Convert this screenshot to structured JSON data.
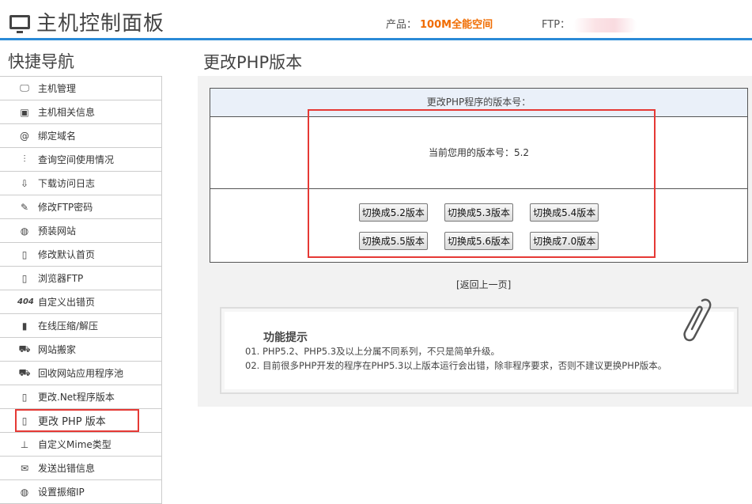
{
  "header": {
    "title": "主机控制面板",
    "product_label": "产品：",
    "product_value": "100M全能空间",
    "ftp_label": "FTP："
  },
  "sidebar": {
    "title": "快捷导航",
    "items": [
      {
        "label": "主机管理",
        "icon": "monitor-icon"
      },
      {
        "label": "主机相关信息",
        "icon": "screen-info-icon"
      },
      {
        "label": "绑定域名",
        "icon": "at-icon"
      },
      {
        "label": "查询空间使用情况",
        "icon": "chart-icon"
      },
      {
        "label": "下载访问日志",
        "icon": "download-icon"
      },
      {
        "label": "修改FTP密码",
        "icon": "edit-icon"
      },
      {
        "label": "预装网站",
        "icon": "globe-icon"
      },
      {
        "label": "修改默认首页",
        "icon": "file-edit-icon"
      },
      {
        "label": "浏览器FTP",
        "icon": "file-icon"
      },
      {
        "label": "自定义出错页",
        "icon": "404-icon"
      },
      {
        "label": "在线压缩/解压",
        "icon": "archive-icon"
      },
      {
        "label": "网站搬家",
        "icon": "truck-icon"
      },
      {
        "label": "回收网站应用程序池",
        "icon": "truck-icon"
      },
      {
        "label": "更改.Net程序版本",
        "icon": "file-code-icon"
      },
      {
        "label": "更改 PHP 版本",
        "icon": "file-icon"
      },
      {
        "label": "自定义Mime类型",
        "icon": "tree-icon"
      },
      {
        "label": "发送出错信息",
        "icon": "mail-icon"
      },
      {
        "label": "设置振缩IP",
        "icon": "globe-icon"
      }
    ]
  },
  "main": {
    "page_title": "更改PHP版本",
    "panel_header": "更改PHP程序的版本号：",
    "current_version_text": "当前您用的版本号：5.2",
    "buttons_row1": [
      "切换成5.2版本",
      "切换成5.3版本",
      "切换成5.4版本"
    ],
    "buttons_row2": [
      "切换成5.5版本",
      "切换成5.6版本",
      "切换成7.0版本"
    ],
    "back_link": "[返回上一页]"
  },
  "tips": {
    "title": "功能提示",
    "lines": [
      "01.  PHP5.2、PHP5.3及以上分属不同系列，不只是简单升级。",
      "02.  目前很多PHP开发的程序在PHP5.3以上版本运行会出错，除非程序要求，否则不建议更换PHP版本。"
    ]
  },
  "colors": {
    "accent_blue": "#2a8ad6",
    "product_orange": "#f06c00",
    "highlight_red": "#e53935"
  }
}
